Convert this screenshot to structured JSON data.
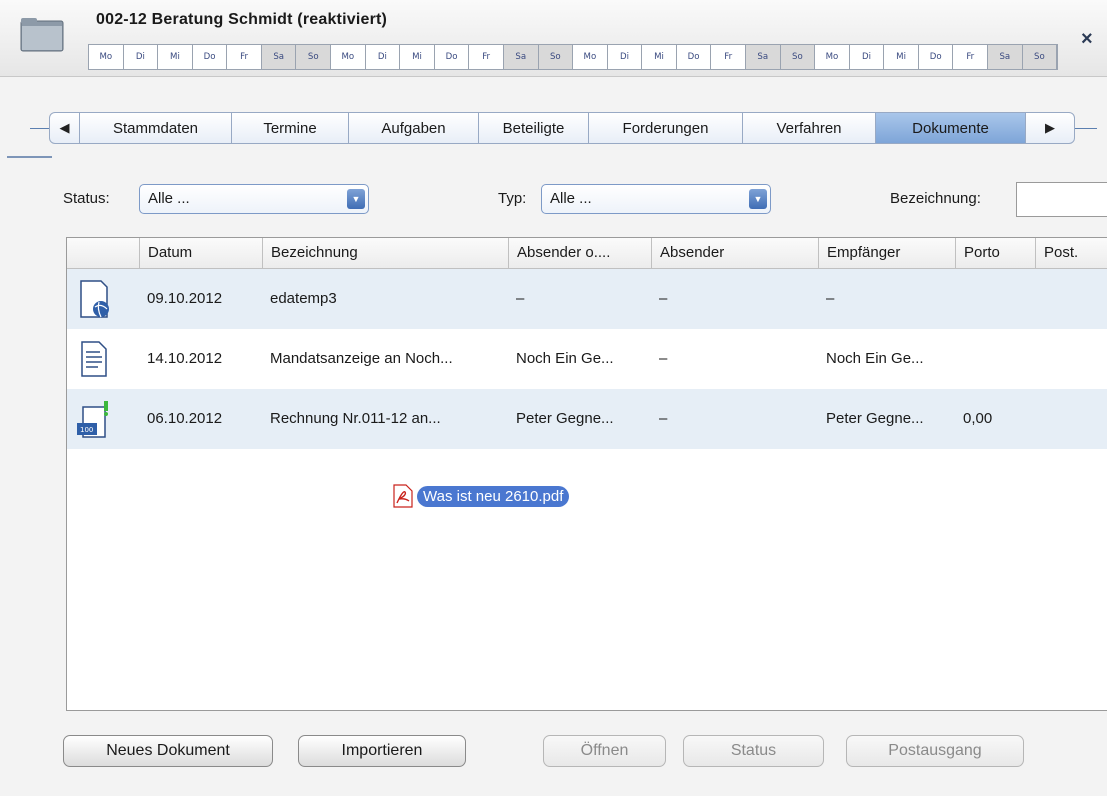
{
  "header": {
    "title": "002-12 Beratung Schmidt (reaktiviert)",
    "close_glyph": "×",
    "days": [
      "Mo",
      "Di",
      "Mi",
      "Do",
      "Fr",
      "Sa",
      "So",
      "Mo",
      "Di",
      "Mi",
      "Do",
      "Fr",
      "Sa",
      "So",
      "Mo",
      "Di",
      "Mi",
      "Do",
      "Fr",
      "Sa",
      "So",
      "Mo",
      "Di",
      "Mi",
      "Do",
      "Fr",
      "Sa",
      "So"
    ]
  },
  "tabs": {
    "prev_glyph": "◀",
    "next_glyph": "▶",
    "items": [
      "Stammdaten",
      "Termine",
      "Aufgaben",
      "Beteiligte",
      "Forderungen",
      "Verfahren",
      "Dokumente"
    ],
    "active": "Dokumente"
  },
  "filters": {
    "status_label": "Status:",
    "status_value": "Alle ...",
    "typ_label": "Typ:",
    "typ_value": "Alle ...",
    "bezeichnung_label": "Bezeichnung:",
    "bezeichnung_value": ""
  },
  "table": {
    "columns": [
      "",
      "Datum",
      "Bezeichnung",
      "Absender o....",
      "Absender",
      "Empfänger",
      "Porto",
      "Post."
    ],
    "rows": [
      {
        "icon": "web-document-icon",
        "datum": "09.10.2012",
        "bezeichnung": "edatemp3",
        "absender_o": "–",
        "absender": "–",
        "empfaenger": "–",
        "porto": "",
        "post": ""
      },
      {
        "icon": "text-document-icon",
        "datum": "14.10.2012",
        "bezeichnung": "Mandatsanzeige an Noch...",
        "absender_o": "Noch Ein Ge...",
        "absender": "–",
        "empfaenger": "Noch Ein Ge...",
        "porto": "",
        "post": ""
      },
      {
        "icon": "invoice-document-icon",
        "datum": "06.10.2012",
        "bezeichnung": "Rechnung Nr.011-12 an...",
        "absender_o": "Peter Gegne...",
        "absender": "–",
        "empfaenger": "Peter Gegne...",
        "porto": "0,00",
        "post": ""
      }
    ],
    "dragged_file": "Was ist neu 2610.pdf"
  },
  "buttons": {
    "neues_dokument": "Neues Dokument",
    "importieren": "Importieren",
    "oeffnen": "Öffnen",
    "status": "Status",
    "postausgang": "Postausgang"
  },
  "colors": {
    "accent": "#4a77d0",
    "active_tab": "#8fb1df",
    "row_alt": "#e6eef6"
  }
}
